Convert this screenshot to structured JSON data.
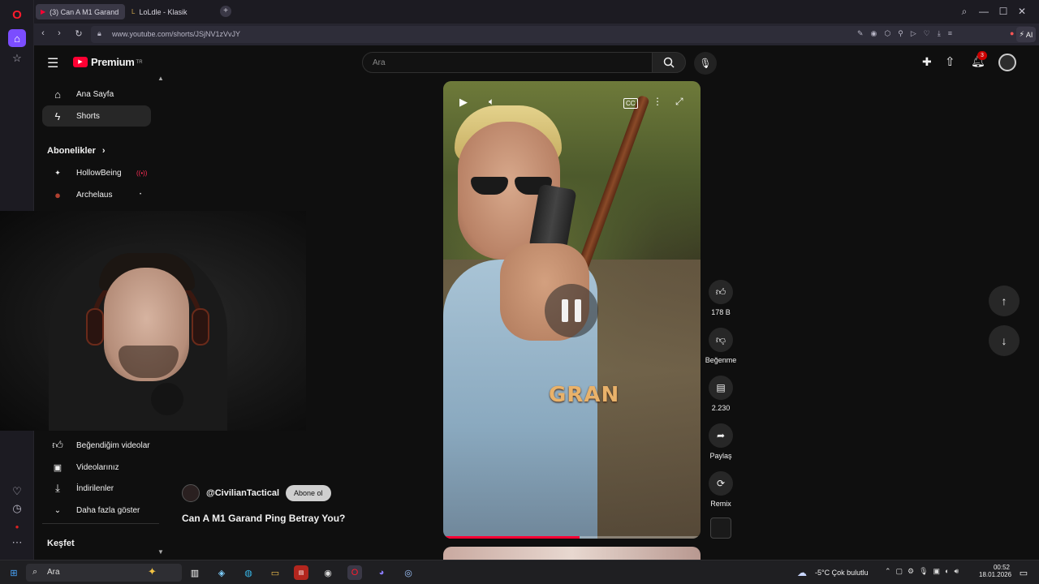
{
  "browser": {
    "tabs": [
      {
        "label": "(3) Can A M1 Garand",
        "active": true
      },
      {
        "label": "LoLdle - Klasik",
        "active": false
      }
    ],
    "url": "www.youtube.com/shorts/JSjNV1zVvJY",
    "ai_label": "AI"
  },
  "youtube": {
    "logo_text": "Premium",
    "logo_region": "TR",
    "search_placeholder": "Ara",
    "notification_count": "3",
    "sidebar": {
      "items": [
        {
          "label": "Ana Sayfa",
          "icon": "home-icon"
        },
        {
          "label": "Shorts",
          "icon": "shorts-icon"
        }
      ],
      "subscriptions_header": "Abonelikler",
      "subscriptions": [
        {
          "label": "HollowBeing"
        },
        {
          "label": "Archelaus"
        }
      ],
      "library": [
        {
          "label": "Beğendiğim videolar",
          "icon": "thumbs-up-icon"
        },
        {
          "label": "Videolarınız",
          "icon": "video-icon"
        },
        {
          "label": "İndirilenler",
          "icon": "download-icon"
        },
        {
          "label": "Daha fazla göster",
          "icon": "chevron-down-icon"
        }
      ],
      "explore_header": "Keşfet"
    },
    "short": {
      "channel": "@CivilianTactical",
      "subscribe_label": "Abone ol",
      "title": "Can A M1 Garand Ping Betray You?",
      "overlay_text": "GRAN",
      "progress": 0.53,
      "actions": {
        "likes": "178 B",
        "dislike_label": "Beğenme",
        "comments": "2.230",
        "share_label": "Paylaş",
        "remix_label": "Remix"
      }
    }
  },
  "taskbar": {
    "search_placeholder": "Ara",
    "weather": "-5°C  Çok bulutlu",
    "time": "00:52",
    "date": "18.01.2026"
  },
  "colors": {
    "youtube_red": "#ff0033",
    "background": "#0f0f0f",
    "opera_red": "#ff1b2d"
  }
}
